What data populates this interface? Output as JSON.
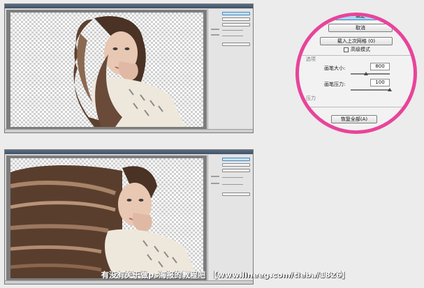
{
  "zoom_panel": {
    "ok_button": "确定",
    "cancel_button": "取消",
    "load_mesh_button": "载入上次网格 (0)",
    "advanced_mode_label": "高级模式",
    "options_heading": "选项",
    "brush_size_label": "画笔大小:",
    "brush_size_value": "800",
    "brush_pressure_label": "画笔压力:",
    "brush_pressure_value": "100",
    "pressure_heading": "压力",
    "restore_all_button": "恢复全部(A)",
    "brush_size_fraction": 0.4,
    "brush_pressure_fraction": 1.0
  },
  "caption": {
    "text": "有没有关于做ps海报的教程吧",
    "url": "【www.lineeg.com/tieba/1826】"
  },
  "colors": {
    "highlight_ring": "#e8449a",
    "primary_button": "#9fd2f2",
    "title_bar": "#3e5166"
  },
  "icons": {
    "window_top": "photo-canvas",
    "window_bottom": "photo-canvas"
  }
}
